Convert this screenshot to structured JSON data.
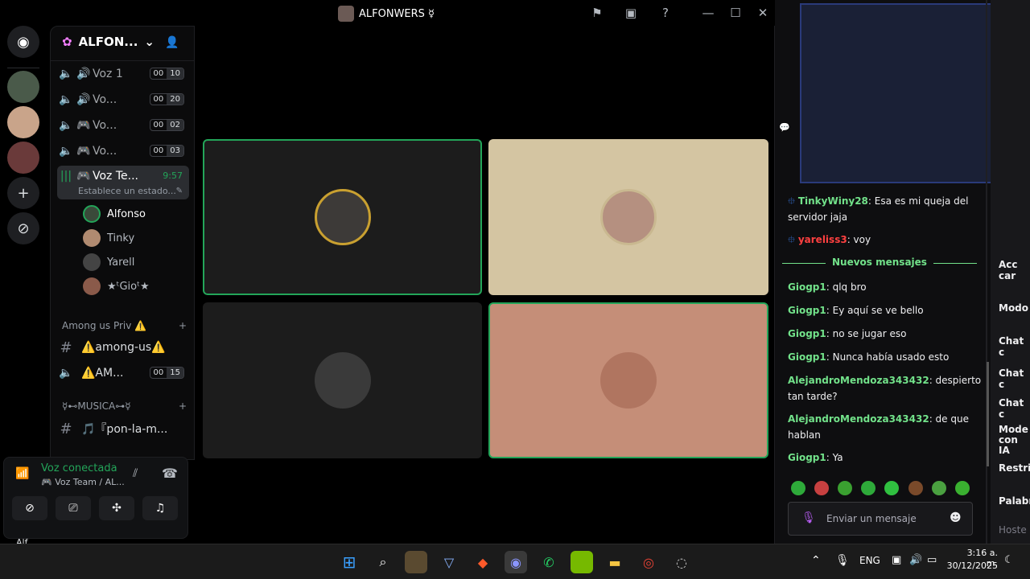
{
  "window": {
    "title": "ALFONWERS ☿"
  },
  "guild": {
    "name": "ALFON..."
  },
  "channels": [
    {
      "name": "Voz 1",
      "a": "00",
      "b": "10"
    },
    {
      "name": "Vo...",
      "a": "00",
      "b": "20"
    },
    {
      "name": "Vo...",
      "a": "00",
      "b": "02"
    },
    {
      "name": "Vo...",
      "a": "00",
      "b": "03"
    }
  ],
  "active_channel": {
    "name": "Voz Te...",
    "time": "9:57",
    "status": "Establece un estado..."
  },
  "voice_users": [
    "Alfonso",
    "Tinky",
    "Yarell",
    "★ᵗGioᵗ★"
  ],
  "categories": {
    "among": "Among us Priv ⚠️",
    "among_text": "⚠️among-us⚠️",
    "among_voice": "⚠️AM...",
    "among_a": "00",
    "among_b": "15",
    "musica": "☿⊷MUSICA⊶☿",
    "musica_text": "🎵『pon-la-m..."
  },
  "voice_panel": {
    "status": "Voz conectada",
    "sub": "🎮 Voz Team / AL...",
    "user": "Alf..."
  },
  "chat": {
    "messages": [
      {
        "user": "TinkyWiny28",
        "text": ": Esa es mi queja del servidor jaja"
      },
      {
        "user": "yareliss3",
        "text": ": voy"
      }
    ],
    "divider": "Nuevos mensajes",
    "new_messages": [
      {
        "user": "Giogp1",
        "text": ": qlq bro"
      },
      {
        "user": "Giogp1",
        "text": ": Ey aquí se ve bello"
      },
      {
        "user": "Giogp1",
        "text": ": no se jugar eso"
      },
      {
        "user": "Giogp1",
        "text": ": Nunca había usado esto"
      },
      {
        "user": "AlejandroMendoza343432",
        "text": ": despierto tan tarde?"
      },
      {
        "user": "AlejandroMendoza343432",
        "text": ": de que hablan"
      },
      {
        "user": "Giogp1",
        "text": ": Ya"
      }
    ],
    "input_placeholder": "Enviar un mensaje"
  },
  "right_menu": [
    "Acc car",
    "Modo",
    "Chat c",
    "Chat c",
    "Chat c",
    "Mode con IA",
    "Restri",
    "Palabr",
    "Hoste"
  ],
  "taskbar": {
    "lang": "ENG",
    "time": "3:16 a. m.",
    "date": "30/12/2025"
  },
  "colors": {
    "accent": "#23a559",
    "twitch_green": "#72e28a",
    "chat_red": "#ff4040"
  }
}
